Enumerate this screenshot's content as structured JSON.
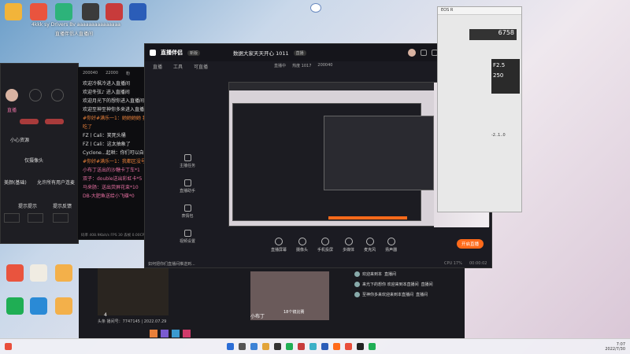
{
  "desktop": {
    "icons_top": [
      {
        "label": "",
        "color": "#f2b43a",
        "glyph": "folder-icon"
      },
      {
        "label": "",
        "color": "#e9543e",
        "glyph": "app-icon"
      },
      {
        "label": "",
        "color": "#2db37a",
        "glyph": "app-icon"
      },
      {
        "label": "",
        "color": "#3b3b3b",
        "glyph": "obs-icon"
      },
      {
        "label": "",
        "color": "#c83b3b",
        "glyph": "app-icon"
      },
      {
        "label": "",
        "color": "#2b5db8",
        "glyph": "word-icon"
      }
    ],
    "overlay_text_1": "4kkk sy Drivers Bv aaaaaaaaaaaaaaa",
    "overlay_text_2": "直播伴侣人直播间"
  },
  "main_window": {
    "app_name": "直播伴侣",
    "badge": "新版",
    "tabs": [
      "直播",
      "工具",
      "可直播"
    ],
    "stream_title": "数据大家天天开心 1011",
    "stream_badge": "直播",
    "stats": [
      "直播中",
      "热度 1017",
      "200040"
    ],
    "toolbar": [
      {
        "label": "直播屏幕"
      },
      {
        "label": "摄像头"
      },
      {
        "label": "手机投屏"
      },
      {
        "label": "多媒体"
      },
      {
        "label": "麦克风"
      },
      {
        "label": "扬声器"
      }
    ],
    "side_tools": [
      {
        "label": "主播任务"
      },
      {
        "label": "直播助手"
      },
      {
        "label": "表情包"
      },
      {
        "label": "视频设置"
      }
    ],
    "start_button": "开启直播",
    "bottom_hint": "如何把你们直播间推送到...",
    "status_bar": "CPU 17%",
    "timer": "00:00:02"
  },
  "chat": {
    "header": [
      "200040",
      "22000",
      "粉"
    ],
    "lines": [
      {
        "text": "欢迎冷枫冷进入直播间",
        "cls": "white"
      },
      {
        "text": "欢迎冬弦♪ 进入直播间",
        "cls": "white"
      },
      {
        "text": "欢迎月光下的想你进入直播间",
        "cls": "white"
      },
      {
        "text": "欢迎至神至神你多来进入直播间",
        "cls": "white"
      },
      {
        "text": "#你好#满乐一1：她她她她 我都想这个",
        "cls": "orange"
      },
      {
        "text": "吃了",
        "cls": "orange"
      },
      {
        "text": "FZ丨Cali：笑死头桶",
        "cls": "white"
      },
      {
        "text": "FZ丨Cali：这太抽象了",
        "cls": "white"
      },
      {
        "text": "Cyclone...起哄：你们可以自由交1v1",
        "cls": "white"
      },
      {
        "text": "#你好#满乐一1：我都区没号",
        "cls": "orange"
      },
      {
        "text": "小布丁送出的沙糖卡丁车*1",
        "cls": "pink"
      },
      {
        "text": "双子：double送出彩虹卡*5",
        "cls": "pink"
      },
      {
        "text": "马来肠：送出荧屏花束*10",
        "cls": "pink"
      },
      {
        "text": "DB-大肥鱼送给小飞碟*0",
        "cls": "pink"
      }
    ],
    "footer": "码率 408.9Kbit/s FPS 30 丢帧 0.00CPU 17% 内存 1%"
  },
  "left_window": {
    "label_1": "直播",
    "label_2": "小心资源",
    "option_1": "仅摄像头",
    "option_2": "美颜(基础)",
    "option_3": "允许所有用户连麦",
    "option_4": "提示提示",
    "option_5": "提示反馈",
    "option_6": "火爆推送"
  },
  "right_window": {
    "title": "EOS R",
    "readout_1": "6758",
    "readout_2": "F2.5",
    "readout_3": "250",
    "readout_4": "-2..1..0"
  },
  "bottom_window": {
    "counter": "4",
    "meta": "头条 播间号：7747145 | 2022.07.29",
    "streamer": "小布丁",
    "overlay_label": "18个镜比赛",
    "comments": [
      {
        "name": "直播间",
        "text": "欢迎来到本"
      },
      {
        "name": "直播间",
        "text": "来光下的想你 欢迎来到本直播间"
      },
      {
        "name": "直播间",
        "text": "至神你多来欢迎来到本直播间"
      }
    ]
  },
  "taskbar": {
    "time": "7:07",
    "date": "2022/7/30"
  }
}
